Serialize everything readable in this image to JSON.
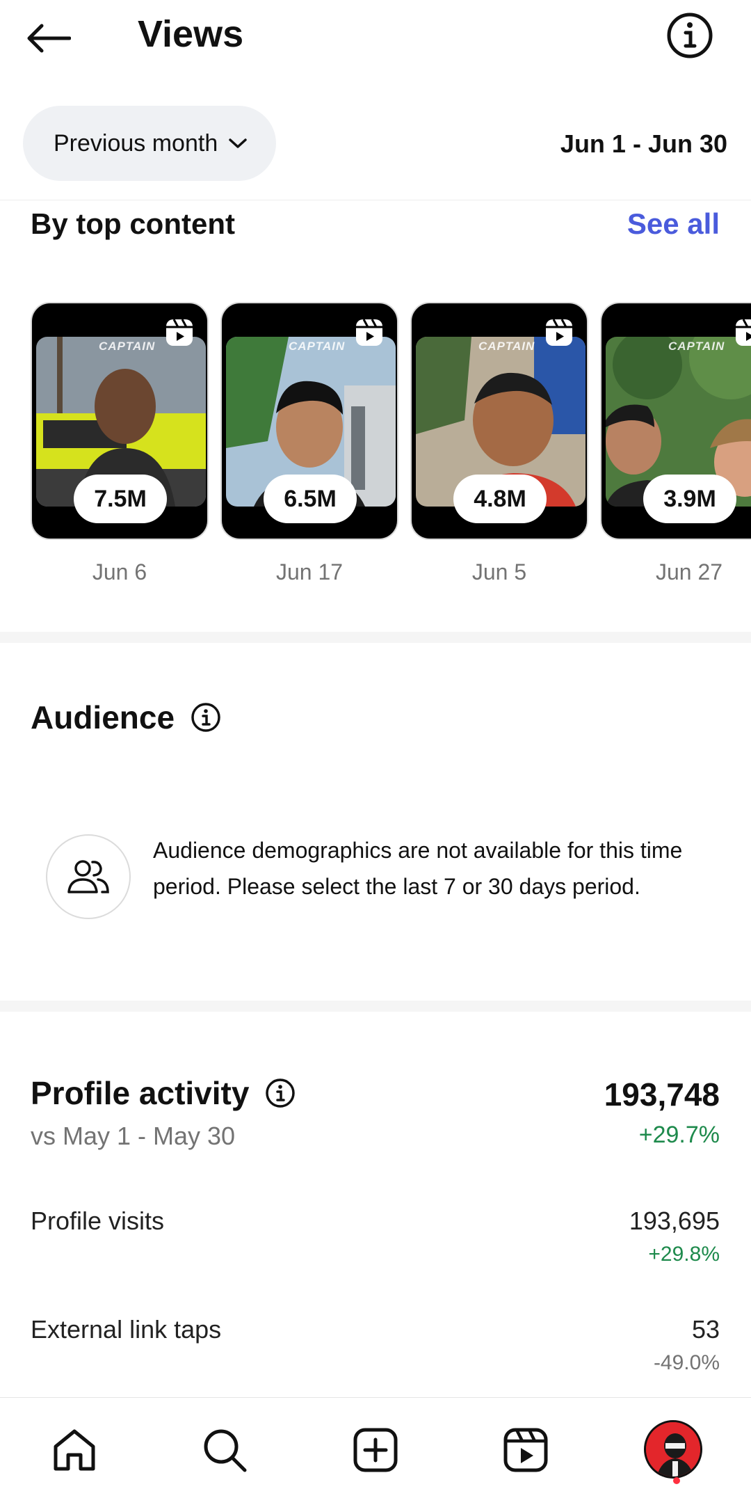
{
  "header": {
    "title": "Views"
  },
  "filter": {
    "period_label": "Previous month",
    "date_range": "Jun 1 - Jun 30"
  },
  "top_content": {
    "title": "By top content",
    "see_all": "See all",
    "reels": [
      {
        "views": "7.5M",
        "date": "Jun 6",
        "caption": "CAPTAIN"
      },
      {
        "views": "6.5M",
        "date": "Jun 17",
        "caption": "CAPTAIN"
      },
      {
        "views": "4.8M",
        "date": "Jun 5",
        "caption": "CAPTAIN"
      },
      {
        "views": "3.9M",
        "date": "Jun 27",
        "caption": "CAPTAIN"
      }
    ]
  },
  "audience": {
    "title": "Audience",
    "message": "Audience demographics are not available for this time period. Please select the last 7 or 30 days period."
  },
  "profile_activity": {
    "title": "Profile activity",
    "compare": "vs May 1 - May 30",
    "total": "193,748",
    "total_change": "+29.7%",
    "metrics": [
      {
        "label": "Profile visits",
        "value": "193,695",
        "change": "+29.8%"
      },
      {
        "label": "External link taps",
        "value": "53",
        "change": "-49.0%"
      }
    ]
  },
  "nav": {
    "items": [
      "home-icon",
      "search-icon",
      "create-icon",
      "reels-icon",
      "profile-avatar"
    ]
  },
  "colors": {
    "accent_link": "#4a5bdc",
    "positive": "#1e8a4c",
    "muted": "#737373",
    "notification": "#ff3040"
  }
}
